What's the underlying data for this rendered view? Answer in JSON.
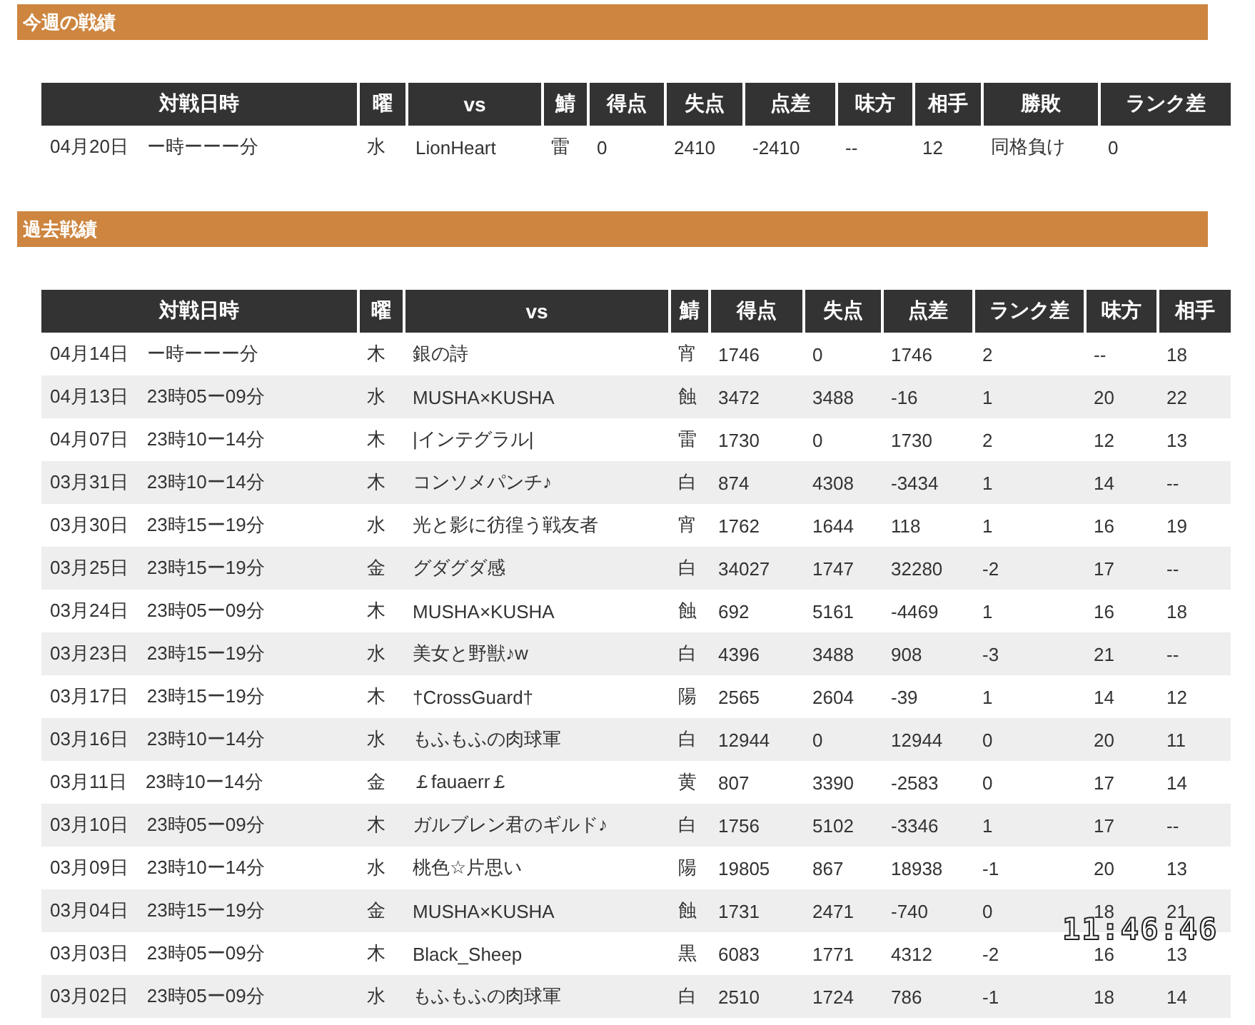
{
  "this_week": {
    "title": "今週の戦績",
    "columns": [
      "対戦日時",
      "曜",
      "vs",
      "鯖",
      "得点",
      "失点",
      "点差",
      "味方",
      "相手",
      "勝敗",
      "ランク差"
    ],
    "rows": [
      [
        "04月20日　ー時ーーー分",
        "水",
        "LionHeart",
        "雷",
        "0",
        "2410",
        "-2410",
        "--",
        "12",
        "同格負け",
        "0"
      ]
    ]
  },
  "past": {
    "title": "過去戦績",
    "columns": [
      "対戦日時",
      "曜",
      "vs",
      "鯖",
      "得点",
      "失点",
      "点差",
      "ランク差",
      "味方",
      "相手"
    ],
    "rows": [
      [
        "04月14日　ー時ーーー分",
        "木",
        "銀の詩",
        "宵",
        "1746",
        "0",
        "1746",
        "2",
        "--",
        "18"
      ],
      [
        "04月13日　23時05ー09分",
        "水",
        "MUSHA×KUSHA",
        "蝕",
        "3472",
        "3488",
        "-16",
        "1",
        "20",
        "22"
      ],
      [
        "04月07日　23時10ー14分",
        "木",
        "|インテグラル|",
        "雷",
        "1730",
        "0",
        "1730",
        "2",
        "12",
        "13"
      ],
      [
        "03月31日　23時10ー14分",
        "木",
        "コンソメパンチ♪",
        "白",
        "874",
        "4308",
        "-3434",
        "1",
        "14",
        "--"
      ],
      [
        "03月30日　23時15ー19分",
        "水",
        "光と影に彷徨う戦友者",
        "宵",
        "1762",
        "1644",
        "118",
        "1",
        "16",
        "19"
      ],
      [
        "03月25日　23時15ー19分",
        "金",
        "グダグダ感",
        "白",
        "34027",
        "1747",
        "32280",
        "-2",
        "17",
        "--"
      ],
      [
        "03月24日　23時05ー09分",
        "木",
        "MUSHA×KUSHA",
        "蝕",
        "692",
        "5161",
        "-4469",
        "1",
        "16",
        "18"
      ],
      [
        "03月23日　23時15ー19分",
        "水",
        "美女と野獣♪w",
        "白",
        "4396",
        "3488",
        "908",
        "-3",
        "21",
        "--"
      ],
      [
        "03月17日　23時15ー19分",
        "木",
        "†CrossGuard†",
        "陽",
        "2565",
        "2604",
        "-39",
        "1",
        "14",
        "12"
      ],
      [
        "03月16日　23時10ー14分",
        "水",
        "もふもふの肉球軍",
        "白",
        "12944",
        "0",
        "12944",
        "0",
        "20",
        "11"
      ],
      [
        "03月11日　23時10ー14分",
        "金",
        "￡fauaerr￡",
        "黄",
        "807",
        "3390",
        "-2583",
        "0",
        "17",
        "14"
      ],
      [
        "03月10日　23時05ー09分",
        "木",
        "ガルブレン君のギルド♪",
        "白",
        "1756",
        "5102",
        "-3346",
        "1",
        "17",
        "--"
      ],
      [
        "03月09日　23時10ー14分",
        "水",
        "桃色☆片思い",
        "陽",
        "19805",
        "867",
        "18938",
        "-1",
        "20",
        "13"
      ],
      [
        "03月04日　23時15ー19分",
        "金",
        "MUSHA×KUSHA",
        "蝕",
        "1731",
        "2471",
        "-740",
        "0",
        "18",
        "21"
      ],
      [
        "03月03日　23時05ー09分",
        "木",
        "Black_Sheep",
        "黒",
        "6083",
        "1771",
        "4312",
        "-2",
        "16",
        "13"
      ],
      [
        "03月02日　23時05ー09分",
        "水",
        "もふもふの肉球軍",
        "白",
        "2510",
        "1724",
        "786",
        "-1",
        "18",
        "14"
      ]
    ]
  },
  "clock": "11:46:46"
}
